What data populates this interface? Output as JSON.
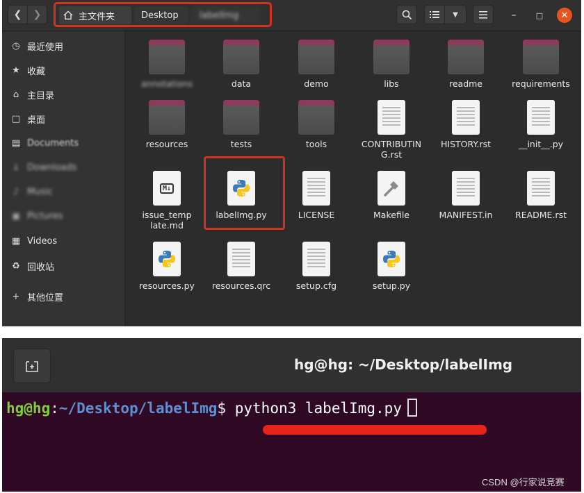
{
  "file_manager": {
    "nav": {
      "back_icon": "chevron-left-icon",
      "forward_icon": "chevron-right-icon"
    },
    "breadcrumb": {
      "home_label": "主文件夹",
      "desktop_label": "Desktop",
      "current_label": "labelImg"
    },
    "sidebar": [
      {
        "label": "最近使用",
        "icon": "clock-icon"
      },
      {
        "label": "收藏",
        "icon": "star-icon"
      },
      {
        "label": "主目录",
        "icon": "home-icon"
      },
      {
        "label": "桌面",
        "icon": "desktop-icon"
      },
      {
        "label": "Documents",
        "icon": "document-icon"
      },
      {
        "label": "Downloads",
        "icon": "download-icon"
      },
      {
        "label": "Music",
        "icon": "music-icon"
      },
      {
        "label": "Pictures",
        "icon": "pictures-icon"
      },
      {
        "label": "Videos",
        "icon": "video-icon"
      },
      {
        "label": "回收站",
        "icon": "trash-icon"
      },
      {
        "label": "其他位置",
        "icon": "plus-icon"
      }
    ],
    "files": [
      {
        "name": "annotations",
        "type": "folder"
      },
      {
        "name": "data",
        "type": "folder"
      },
      {
        "name": "demo",
        "type": "folder"
      },
      {
        "name": "libs",
        "type": "folder"
      },
      {
        "name": "readme",
        "type": "folder"
      },
      {
        "name": "requirements",
        "type": "folder"
      },
      {
        "name": "resources",
        "type": "folder"
      },
      {
        "name": "tests",
        "type": "folder"
      },
      {
        "name": "tools",
        "type": "folder"
      },
      {
        "name": "CONTRIBUTING.rst",
        "type": "text"
      },
      {
        "name": "HISTORY.rst",
        "type": "text"
      },
      {
        "name": "__init__.py",
        "type": "text"
      },
      {
        "name": "issue_template.md",
        "type": "markdown"
      },
      {
        "name": "labelImg.py",
        "type": "python"
      },
      {
        "name": "LICENSE",
        "type": "text"
      },
      {
        "name": "Makefile",
        "type": "makefile"
      },
      {
        "name": "MANIFEST.in",
        "type": "text"
      },
      {
        "name": "README.rst",
        "type": "text"
      },
      {
        "name": "resources.py",
        "type": "python"
      },
      {
        "name": "resources.qrc",
        "type": "text"
      },
      {
        "name": "setup.cfg",
        "type": "text"
      },
      {
        "name": "setup.py",
        "type": "python"
      }
    ]
  },
  "terminal": {
    "title": "hg@hg: ~/Desktop/labelImg",
    "prompt_user": "hg@hg",
    "prompt_colon": ":",
    "prompt_path": "~/Desktop/labelImg",
    "prompt_dollar": "$",
    "command": " python3 labelImg.py"
  },
  "watermark": "CSDN @行家说竞赛",
  "colors": {
    "highlight_red": "#d2331f",
    "folder_tab": "#8e3a5c",
    "terminal_bg": "#300a24",
    "prompt_green": "#7fcf39",
    "prompt_blue": "#5f8fd1"
  }
}
